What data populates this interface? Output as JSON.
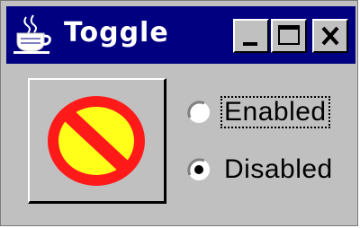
{
  "window": {
    "title": "Toggle",
    "title_bar_color": "#000080",
    "controls": [
      {
        "name": "minimize",
        "icon": "minimize-icon"
      },
      {
        "name": "maximize",
        "icon": "maximize-icon"
      },
      {
        "name": "close",
        "icon": "close-icon"
      }
    ]
  },
  "toggle_button": {
    "icon": "no-entry-icon",
    "icon_colors": {
      "ring": "#ff1a1a",
      "fill": "#ffff1a"
    }
  },
  "options": [
    {
      "label": "Enabled",
      "selected": false,
      "focused": true
    },
    {
      "label": "Disabled",
      "selected": true,
      "focused": false
    }
  ]
}
